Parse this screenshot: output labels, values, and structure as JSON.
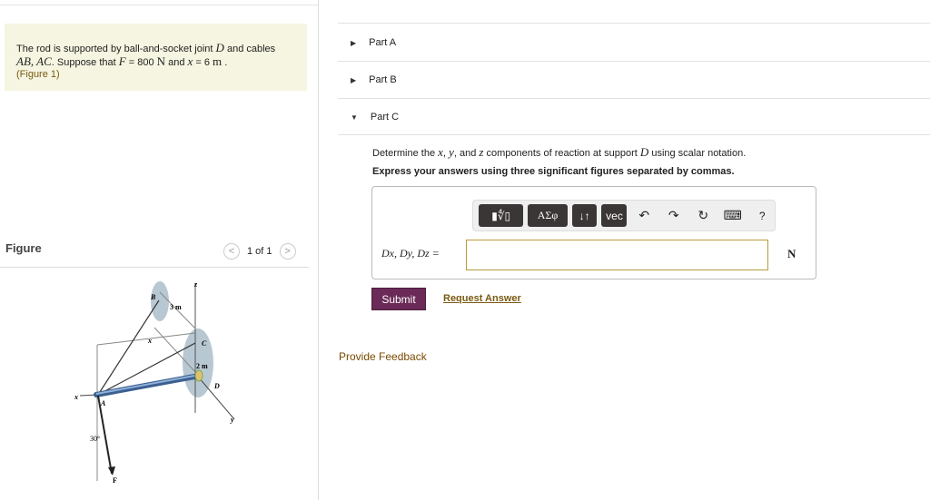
{
  "problem": {
    "t1": "The rod is supported by ball-and-socket joint ",
    "D": "D",
    "t2": " and cables",
    "AB": "AB, AC",
    "t3": ". Suppose that ",
    "F": "F",
    "t4": " = 800 ",
    "N": "N",
    "t5": " and ",
    "x": "x",
    "t6": " = 6 ",
    "m": "m",
    "t7": " .",
    "figure_link": "(Figure 1)"
  },
  "figure": {
    "label": "Figure",
    "pager": "1 of 1",
    "prev": "<",
    "next": ">",
    "labels": {
      "B": "B",
      "C": "C",
      "A": "A",
      "D": "D",
      "x_axis": "x",
      "x_dim": "x",
      "y": "y",
      "z": "z",
      "F": "F",
      "d3": "3 m",
      "d2": "2 m",
      "angle": "30°"
    }
  },
  "parts": [
    {
      "label": "Part A",
      "state": "collapsed"
    },
    {
      "label": "Part B",
      "state": "collapsed"
    },
    {
      "label": "Part C",
      "state": "expanded"
    }
  ],
  "partC": {
    "q1a": "Determine the ",
    "x": "x",
    ", ": ", ",
    "y": "y",
    "q1b": ", and ",
    "z": "z",
    "q1c": " components of reaction at support ",
    "D": "D",
    "q1d": " using scalar notation.",
    "q2": "Express your answers using three significant figures separated by commas.",
    "toolbar": {
      "templates": "▮∜▯",
      "greek": "ΑΣφ",
      "arrows": "↓↑",
      "vec": "vec",
      "undo": "↶",
      "redo": "↷",
      "reset": "↻",
      "keyboard": "⌨",
      "help": "?"
    },
    "lhs": "Dx, Dy, Dz =",
    "answer_value": "",
    "unit": "N",
    "submit": "Submit",
    "request": "Request Answer"
  },
  "feedback": "Provide Feedback"
}
